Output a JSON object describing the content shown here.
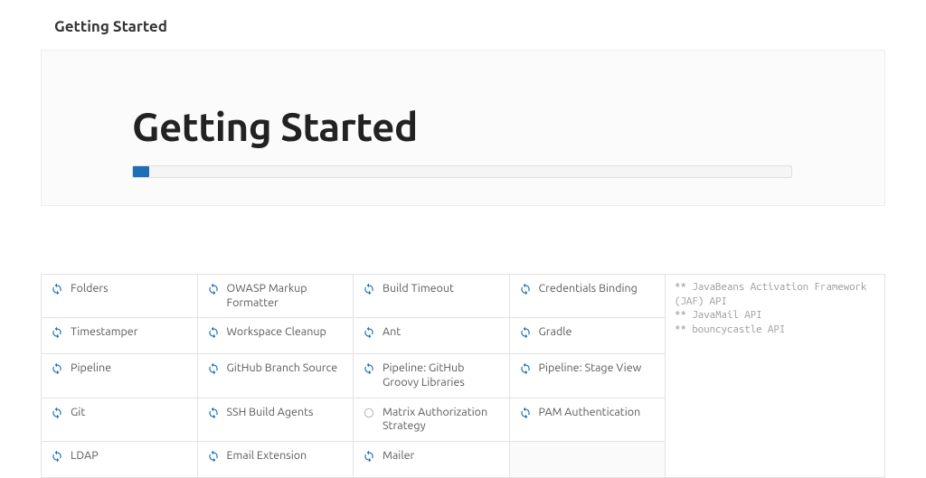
{
  "header": {
    "title": "Getting Started"
  },
  "hero": {
    "title": "Getting Started",
    "progress_percent": 2.5
  },
  "plugins": {
    "rows": [
      [
        {
          "name": "Folders",
          "state": "pending"
        },
        {
          "name": "OWASP Markup Formatter",
          "state": "pending"
        },
        {
          "name": "Build Timeout",
          "state": "pending"
        },
        {
          "name": "Credentials Binding",
          "state": "pending"
        }
      ],
      [
        {
          "name": "Timestamper",
          "state": "pending"
        },
        {
          "name": "Workspace Cleanup",
          "state": "pending"
        },
        {
          "name": "Ant",
          "state": "pending"
        },
        {
          "name": "Gradle",
          "state": "pending"
        }
      ],
      [
        {
          "name": "Pipeline",
          "state": "pending"
        },
        {
          "name": "GitHub Branch Source",
          "state": "pending"
        },
        {
          "name": "Pipeline: GitHub Groovy Libraries",
          "state": "pending"
        },
        {
          "name": "Pipeline: Stage View",
          "state": "pending"
        }
      ],
      [
        {
          "name": "Git",
          "state": "pending"
        },
        {
          "name": "SSH Build Agents",
          "state": "pending"
        },
        {
          "name": "Matrix Authorization Strategy",
          "state": "loading"
        },
        {
          "name": "PAM Authentication",
          "state": "pending"
        }
      ],
      [
        {
          "name": "LDAP",
          "state": "pending"
        },
        {
          "name": "Email Extension",
          "state": "pending"
        },
        {
          "name": "Mailer",
          "state": "pending"
        },
        {
          "name": "",
          "state": "empty"
        }
      ]
    ]
  },
  "log": "** JavaBeans Activation Framework (JAF) API\n** JavaMail API\n** bouncycastle API"
}
